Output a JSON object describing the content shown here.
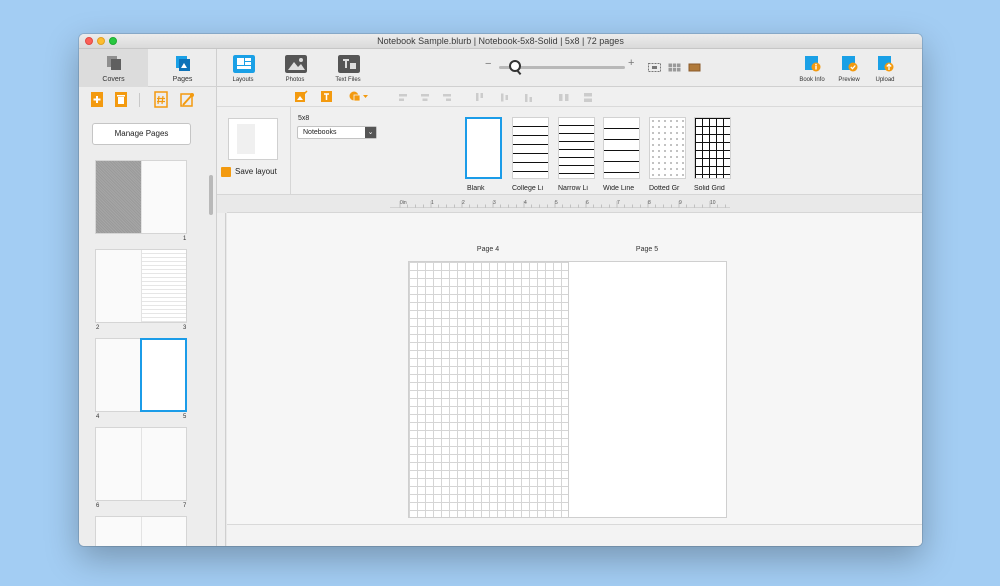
{
  "window": {
    "title": "Notebook Sample.blurb | Notebook-5x8-Solid | 5x8 | 72 pages"
  },
  "sidebar": {
    "tabs": [
      {
        "label": "Covers",
        "icon": "covers-icon",
        "active": true
      },
      {
        "label": "Pages",
        "icon": "pages-icon",
        "active": false
      }
    ],
    "tools": [
      "add-page-icon",
      "delete-page-icon",
      "page-number-icon",
      "wand-icon"
    ],
    "manage_pages_label": "Manage Pages",
    "thumbnails": [
      {
        "left": "",
        "right": "1"
      },
      {
        "left": "2",
        "right": "3"
      },
      {
        "left": "4",
        "right": "5",
        "selected": true
      },
      {
        "left": "6",
        "right": "7"
      }
    ]
  },
  "toolbar": {
    "layouts_label": "Layouts",
    "photos_label": "Photos",
    "text_files_label": "Text Files",
    "zoom_minus": "−",
    "zoom_plus": "+",
    "book_info_label": "Book Info",
    "preview_label": "Preview",
    "upload_label": "Upload"
  },
  "layout_panel": {
    "save_layout_label": "Save layout",
    "size_label": "5x8",
    "category_value": "Notebooks",
    "templates": [
      {
        "label": "Blank",
        "pattern": "blank",
        "active": true
      },
      {
        "label": "College Li",
        "pattern": "college",
        "active": false
      },
      {
        "label": "Narrow Li",
        "pattern": "narrow",
        "active": false
      },
      {
        "label": "Wide Line",
        "pattern": "wide",
        "active": false
      },
      {
        "label": "Dotted Gr",
        "pattern": "dotted",
        "active": false
      },
      {
        "label": "Solid Grid",
        "pattern": "solid",
        "active": false
      }
    ]
  },
  "ruler": {
    "labels": [
      "0in",
      "1",
      "2",
      "3",
      "4",
      "5",
      "6",
      "7",
      "8",
      "9",
      "10"
    ]
  },
  "spread": {
    "left_label": "Page 4",
    "right_label": "Page 5"
  },
  "colors": {
    "accent": "#1b9ce8",
    "orange": "#f39a0f",
    "selection_border": "#1b9ce8"
  }
}
